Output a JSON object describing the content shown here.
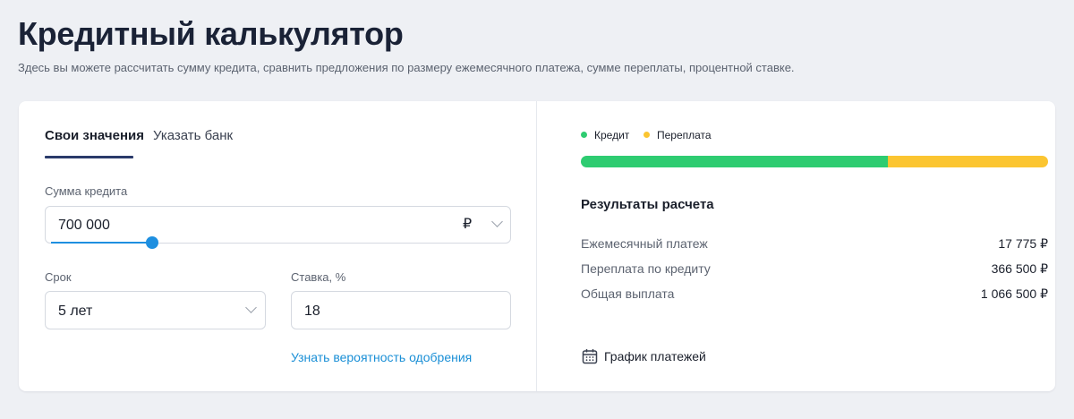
{
  "page": {
    "title": "Кредитный калькулятор",
    "subtitle": "Здесь вы можете рассчитать сумму кредита, сравнить предложения по размеру ежемесячного платежа, сумме переплаты, процентной ставке."
  },
  "tabs": [
    {
      "label": "Свои значения",
      "active": true
    },
    {
      "label": "Указать банк",
      "active": false
    }
  ],
  "form": {
    "amount": {
      "label": "Сумма кредита",
      "value": "700 000",
      "currency": "₽",
      "slider_fraction": 0.22
    },
    "term": {
      "label": "Срок",
      "value": "5 лет"
    },
    "rate": {
      "label": "Ставка, %",
      "value": "18"
    },
    "approval_link": "Узнать вероятность одобрения"
  },
  "legend": [
    {
      "label": "Кредит",
      "color": "#2ecc71"
    },
    {
      "label": "Переплата",
      "color": "#fbc531"
    }
  ],
  "breakdown": {
    "credit": 700000,
    "overpayment": 366500
  },
  "results": {
    "title": "Результаты расчета",
    "rows": [
      {
        "label": "Ежемесячный платеж",
        "value": "17 775 ₽"
      },
      {
        "label": "Переплата по кредиту",
        "value": "366 500 ₽"
      },
      {
        "label": "Общая выплата",
        "value": "1 066 500 ₽"
      }
    ],
    "schedule_label": "График платежей",
    "schedule_icon": "calendar-icon"
  },
  "colors": {
    "accent": "#1e8fe0",
    "tab_underline": "#2a3a6a",
    "credit": "#2ecc71",
    "overpayment": "#fbc531"
  }
}
